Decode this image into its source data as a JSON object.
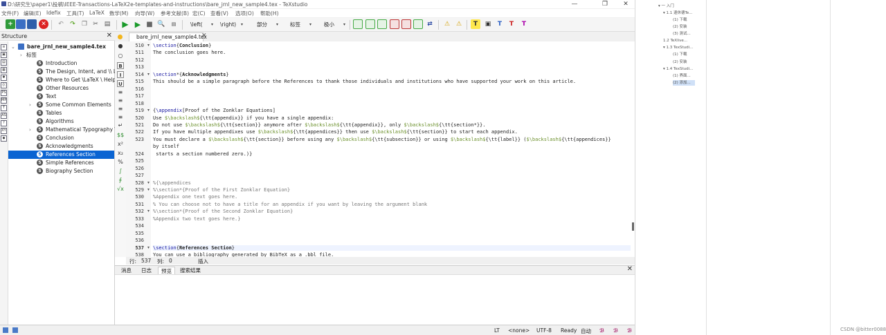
{
  "window": {
    "title": "D:\\研究生\\paper1\\投稿\\IEEE-Transactions-LaTeX2e-templates-and-instructions\\bare_jrnl_new_sample4.tex - TeXstudio",
    "controls": {
      "minimize": "—",
      "restore": "❐",
      "close": "✕"
    }
  },
  "menu": [
    "文件(F)",
    "编辑(E)",
    "Idefix",
    "工具(T)",
    "LaTeX",
    "数学(M)",
    "向导(W)",
    "参考文献(B)",
    "宏(C)",
    "查看(V)",
    "选项(O)",
    "帮助(H)"
  ],
  "toolbar": {
    "combos": [
      "\\left(",
      "\\right)",
      "部分",
      "标签",
      "极小"
    ]
  },
  "structure": {
    "title": "Structure",
    "close": "✕",
    "side_icons": [
      "≡",
      "▣",
      "▤",
      "▦",
      "✱",
      "{(",
      "PS",
      "MP",
      "T",
      "AS",
      "?",
      "XY",
      "◆"
    ],
    "rows": [
      {
        "text": "bare_jrnl_new_sample4.tex",
        "indent": 0,
        "expander": "⌄",
        "icon": "file",
        "bold": true
      },
      {
        "text": "标签",
        "indent": 1,
        "expander": "›",
        "icon": "none"
      },
      {
        "text": "Introduction",
        "indent": 2,
        "expander": "",
        "icon": "S"
      },
      {
        "text": "The Design, Intent, and \\\\ Limi...",
        "indent": 2,
        "expander": "",
        "icon": "S"
      },
      {
        "text": "Where to Get \\LaTeX \\ Help —...",
        "indent": 2,
        "expander": "",
        "icon": "S"
      },
      {
        "text": "Other Resources",
        "indent": 2,
        "expander": "",
        "icon": "S"
      },
      {
        "text": "Text",
        "indent": 2,
        "expander": "",
        "icon": "S"
      },
      {
        "text": "Some Common Elements",
        "indent": 2,
        "expander": "›",
        "icon": "S"
      },
      {
        "text": "Tables",
        "indent": 2,
        "expander": "",
        "icon": "S"
      },
      {
        "text": "Algorithms",
        "indent": 2,
        "expander": "",
        "icon": "S"
      },
      {
        "text": "Mathematical Typography \\\\ a...",
        "indent": 2,
        "expander": "›",
        "icon": "S"
      },
      {
        "text": "Conclusion",
        "indent": 2,
        "expander": "",
        "icon": "S"
      },
      {
        "text": "Acknowledgments",
        "indent": 2,
        "expander": "",
        "icon": "S"
      },
      {
        "text": "References Section",
        "indent": 2,
        "expander": "",
        "icon": "S",
        "selected": true
      },
      {
        "text": "Simple References",
        "indent": 2,
        "expander": "",
        "icon": "S"
      },
      {
        "text": "Biography Section",
        "indent": 2,
        "expander": "",
        "icon": "S"
      }
    ]
  },
  "editor": {
    "tab_label": "bare_jrnl_new_sample4.tex",
    "tab_close": "✕",
    "tool_icons": [
      "●",
      "○",
      "B",
      "I",
      "U",
      "≡",
      "≡",
      "≡",
      "≡",
      "↵",
      "$$",
      "x²",
      "x₂",
      "%",
      "∫",
      "∮",
      "√x"
    ],
    "lines": [
      {
        "n": "510",
        "fold": "▾",
        "segs": [
          [
            "kw",
            "\\section"
          ],
          [
            "",
            "{"
          ],
          [
            "b",
            "Conclusion"
          ],
          [
            "",
            "}"
          ]
        ]
      },
      {
        "n": "511",
        "fold": "",
        "segs": [
          [
            "",
            "The conclusion goes here."
          ]
        ]
      },
      {
        "n": "512",
        "fold": "",
        "segs": []
      },
      {
        "n": "513",
        "fold": "",
        "segs": []
      },
      {
        "n": "514",
        "fold": "▾",
        "segs": [
          [
            "kw",
            "\\section"
          ],
          [
            "",
            "*{"
          ],
          [
            "b",
            "Acknowledgments"
          ],
          [
            "",
            "}"
          ]
        ]
      },
      {
        "n": "515",
        "fold": "",
        "segs": [
          [
            "",
            "This should be a simple paragraph before the References to thank those individuals and institutions who have supported your work on this article."
          ]
        ]
      },
      {
        "n": "516",
        "fold": "",
        "segs": []
      },
      {
        "n": "517",
        "fold": "",
        "segs": []
      },
      {
        "n": "518",
        "fold": "",
        "segs": []
      },
      {
        "n": "519",
        "fold": "▾",
        "segs": [
          [
            "",
            "{"
          ],
          [
            "kw",
            "\\appendix"
          ],
          [
            "",
            "[Proof of the Zonklar Equations]"
          ]
        ]
      },
      {
        "n": "520",
        "fold": "",
        "segs": [
          [
            "",
            "Use "
          ],
          [
            "mth",
            "$\\backslash$"
          ],
          [
            "",
            "{\\tt{appendix}} if you have a single appendix:"
          ]
        ]
      },
      {
        "n": "521",
        "fold": "",
        "segs": [
          [
            "",
            "Do not use "
          ],
          [
            "mth",
            "$\\backslash$"
          ],
          [
            "",
            "{\\tt{section}} anymore after "
          ],
          [
            "mth",
            "$\\backslash$"
          ],
          [
            "",
            "{\\tt{appendix}}, only "
          ],
          [
            "mth",
            "$\\backslash$"
          ],
          [
            "",
            "{\\tt{section*}}."
          ]
        ]
      },
      {
        "n": "522",
        "fold": "",
        "segs": [
          [
            "",
            "If you have multiple appendixes use "
          ],
          [
            "mth",
            "$\\backslash$"
          ],
          [
            "",
            "{\\tt{appendices}} then use "
          ],
          [
            "mth",
            "$\\backslash$"
          ],
          [
            "",
            "{\\tt{section}} to start each appendix."
          ]
        ]
      },
      {
        "n": "523",
        "fold": "",
        "segs": [
          [
            "",
            "You must declare a "
          ],
          [
            "mth",
            "$\\backslash$"
          ],
          [
            "",
            "{\\tt{section}} before using any "
          ],
          [
            "mth",
            "$\\backslash$"
          ],
          [
            "",
            "{\\tt{subsection}} or using "
          ],
          [
            "mth",
            "$\\backslash$"
          ],
          [
            "",
            "{\\tt{label}} ("
          ],
          [
            "mth",
            "$\\backslash$"
          ],
          [
            "",
            "{\\tt{appendices}}"
          ]
        ]
      },
      {
        "n": "",
        "fold": "",
        "segs": [
          [
            "",
            "by itself"
          ]
        ]
      },
      {
        "n": "524",
        "fold": "",
        "segs": [
          [
            "",
            " starts a section numbered zero.)}"
          ]
        ]
      },
      {
        "n": "525",
        "fold": "",
        "segs": []
      },
      {
        "n": "526",
        "fold": "",
        "segs": []
      },
      {
        "n": "527",
        "fold": "",
        "segs": []
      },
      {
        "n": "528",
        "fold": "▾",
        "segs": [
          [
            "cmt",
            "%{\\appendices"
          ]
        ]
      },
      {
        "n": "529",
        "fold": "▾",
        "segs": [
          [
            "cmt",
            "%\\section*{Proof of the First Zonklar Equation}"
          ]
        ]
      },
      {
        "n": "530",
        "fold": "",
        "segs": [
          [
            "cmt",
            "%Appendix one text goes here."
          ]
        ]
      },
      {
        "n": "531",
        "fold": "",
        "segs": [
          [
            "cmt",
            "% You can choose not to have a title for an appendix if you want by leaving the argument blank"
          ]
        ]
      },
      {
        "n": "532",
        "fold": "▾",
        "segs": [
          [
            "cmt",
            "%\\section*{Proof of the Second Zonklar Equation}"
          ]
        ]
      },
      {
        "n": "533",
        "fold": "",
        "segs": [
          [
            "cmt",
            "%Appendix two text goes here.}"
          ]
        ]
      },
      {
        "n": "534",
        "fold": "",
        "segs": []
      },
      {
        "n": "535",
        "fold": "",
        "segs": []
      },
      {
        "n": "536",
        "fold": "",
        "segs": []
      },
      {
        "n": "537",
        "fold": "▾",
        "current": true,
        "segs": [
          [
            "kw",
            "\\section"
          ],
          [
            "",
            "{"
          ],
          [
            "b",
            "References Section"
          ],
          [
            "",
            "}"
          ]
        ]
      },
      {
        "n": "538",
        "fold": "",
        "segs": [
          [
            "",
            "You can use a bibliography generated by BibTeX as a .bbl file."
          ]
        ]
      }
    ],
    "status": {
      "row_label": "行:",
      "row": "537",
      "col_label": "列:",
      "col": "0",
      "mode": "插入"
    }
  },
  "messages": {
    "tabs": [
      "消息",
      "日志",
      "预览",
      "搜索结果"
    ],
    "active": 2,
    "close": "✕"
  },
  "statusbar": {
    "lt": "LT",
    "lang": "<none>",
    "encoding": "UTF-8",
    "ready": "Ready",
    "auto": "自动"
  },
  "toc": [
    {
      "text": "▾ 一 入门",
      "indent": 0
    },
    {
      "text": "▾ 1.1 退休德Te...",
      "indent": 1
    },
    {
      "text": "(1) 下载",
      "indent": 3
    },
    {
      "text": "(2) 安装",
      "indent": 3
    },
    {
      "text": "(3) 测试...",
      "indent": 3
    },
    {
      "text": "1.2 TeXlive...",
      "indent": 1
    },
    {
      "text": "▾ 1.3 TexStudi...",
      "indent": 1
    },
    {
      "text": "(1) 下载",
      "indent": 3
    },
    {
      "text": "(2) 安装",
      "indent": 3
    },
    {
      "text": "▾ 1.4 TexStudi...",
      "indent": 1
    },
    {
      "text": "(1) 界面...",
      "indent": 3
    },
    {
      "text": "(2) 添加...",
      "indent": 3,
      "selected": true
    }
  ],
  "watermark": "CSDN @bitter0088",
  "colors": {
    "accent": "#0a64d2",
    "keyword": "#1515a0",
    "math": "#6a8f2a",
    "comment": "#777777"
  }
}
